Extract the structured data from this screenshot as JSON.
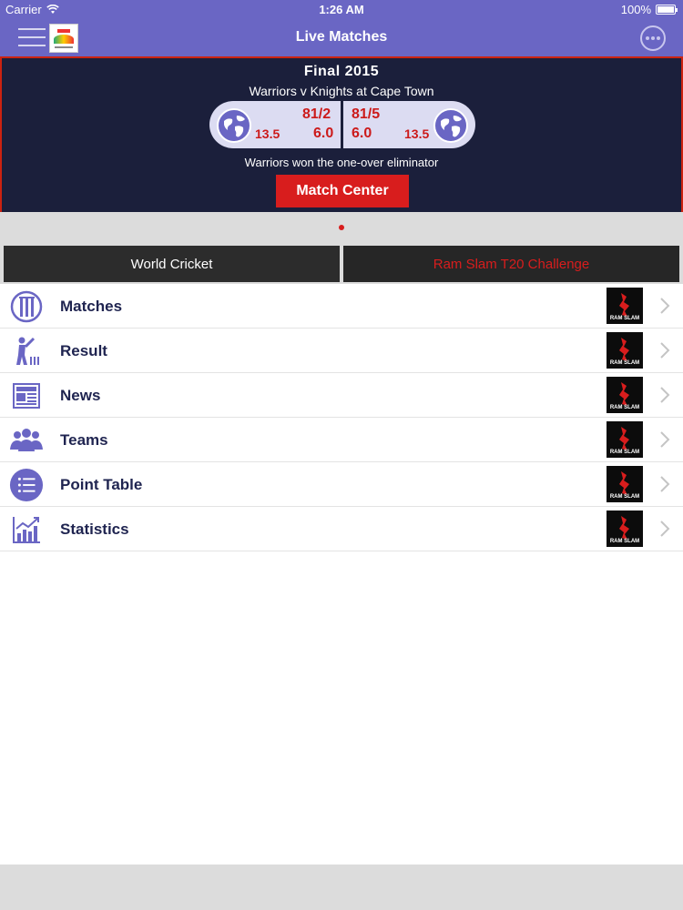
{
  "status_bar": {
    "carrier": "Carrier",
    "time": "1:26 AM",
    "battery": "100%"
  },
  "nav": {
    "title": "Live Matches"
  },
  "match": {
    "title": "Final 2015",
    "subtitle": "Warriors v Knights at Cape Town",
    "team1_score": "81/2",
    "team1_overs": "6.0",
    "team1_rr": "13.5",
    "team2_score": "81/5",
    "team2_overs": "6.0",
    "team2_rr": "13.5",
    "result": "Warriors won the one-over eliminator",
    "match_center_label": "Match Center"
  },
  "tabs": [
    {
      "label": "World Cricket"
    },
    {
      "label": "Ram Slam T20 Challenge"
    }
  ],
  "menu": [
    {
      "label": "Matches",
      "icon": "wickets-icon"
    },
    {
      "label": "Result",
      "icon": "batsman-icon"
    },
    {
      "label": "News",
      "icon": "newspaper-icon"
    },
    {
      "label": "Teams",
      "icon": "group-icon"
    },
    {
      "label": "Point Table",
      "icon": "list-icon"
    },
    {
      "label": "Statistics",
      "icon": "chart-icon"
    }
  ],
  "thumbnail_text": "RAM SLAM",
  "colors": {
    "nav": "#6a66c4",
    "banner": "#1b1f3b",
    "accent": "#d81d1d",
    "label": "#1f2450"
  }
}
